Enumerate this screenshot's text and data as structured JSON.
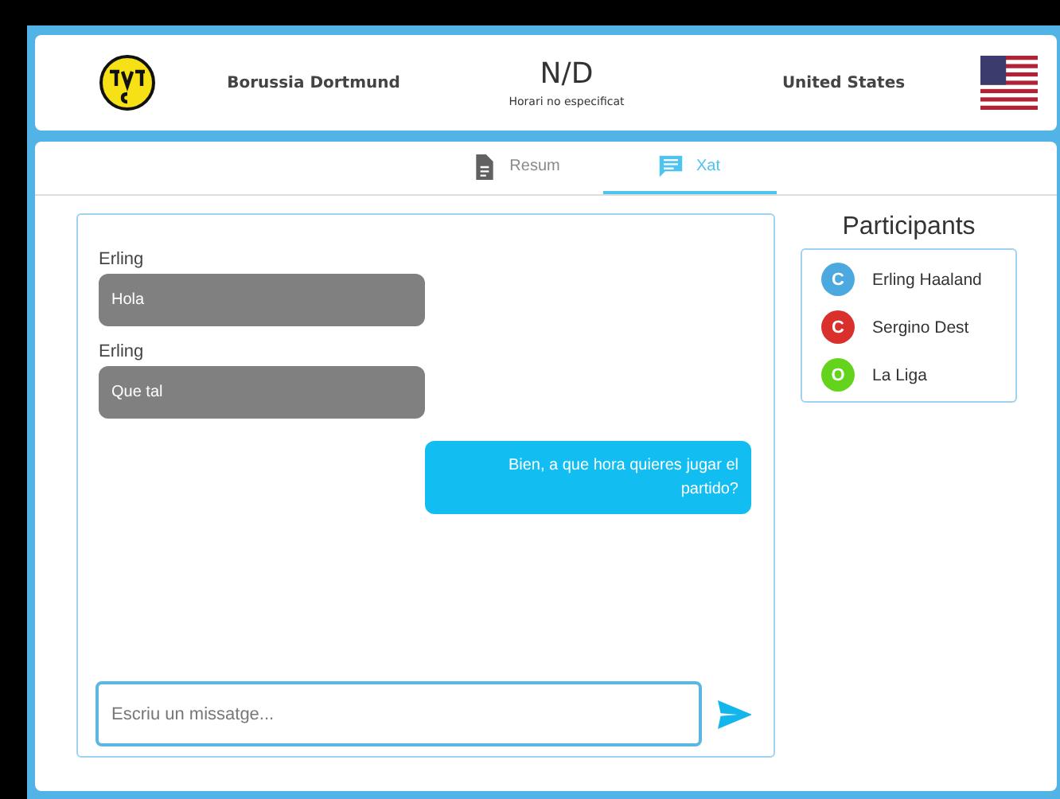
{
  "match": {
    "home_team": "Borussia Dortmund",
    "score": "N/D",
    "schedule": "Horari no especificat",
    "away_team": "United States"
  },
  "tabs": [
    {
      "label": "Resum",
      "kind": "document",
      "selected": false
    },
    {
      "label": "Xat",
      "kind": "chat",
      "selected": true
    }
  ],
  "chat": {
    "messages": [
      {
        "kind": "incoming",
        "sender": "Erling",
        "text": "Hola"
      },
      {
        "kind": "incoming",
        "sender": "Erling",
        "text": "Que tal"
      },
      {
        "kind": "outgoing",
        "text": "Bien, a que hora quieres jugar el partido?"
      }
    ],
    "input": {
      "placeholder": "Escriu un missatge..."
    }
  },
  "participants": {
    "title": "Participants",
    "items": [
      {
        "initial": "C",
        "name": "Erling Haaland",
        "color": "#4ba9e0"
      },
      {
        "initial": "C",
        "name": "Sergino Dest",
        "color": "#d9302c"
      },
      {
        "initial": "O",
        "name": "La Liga",
        "color": "#63d31c"
      }
    ]
  }
}
